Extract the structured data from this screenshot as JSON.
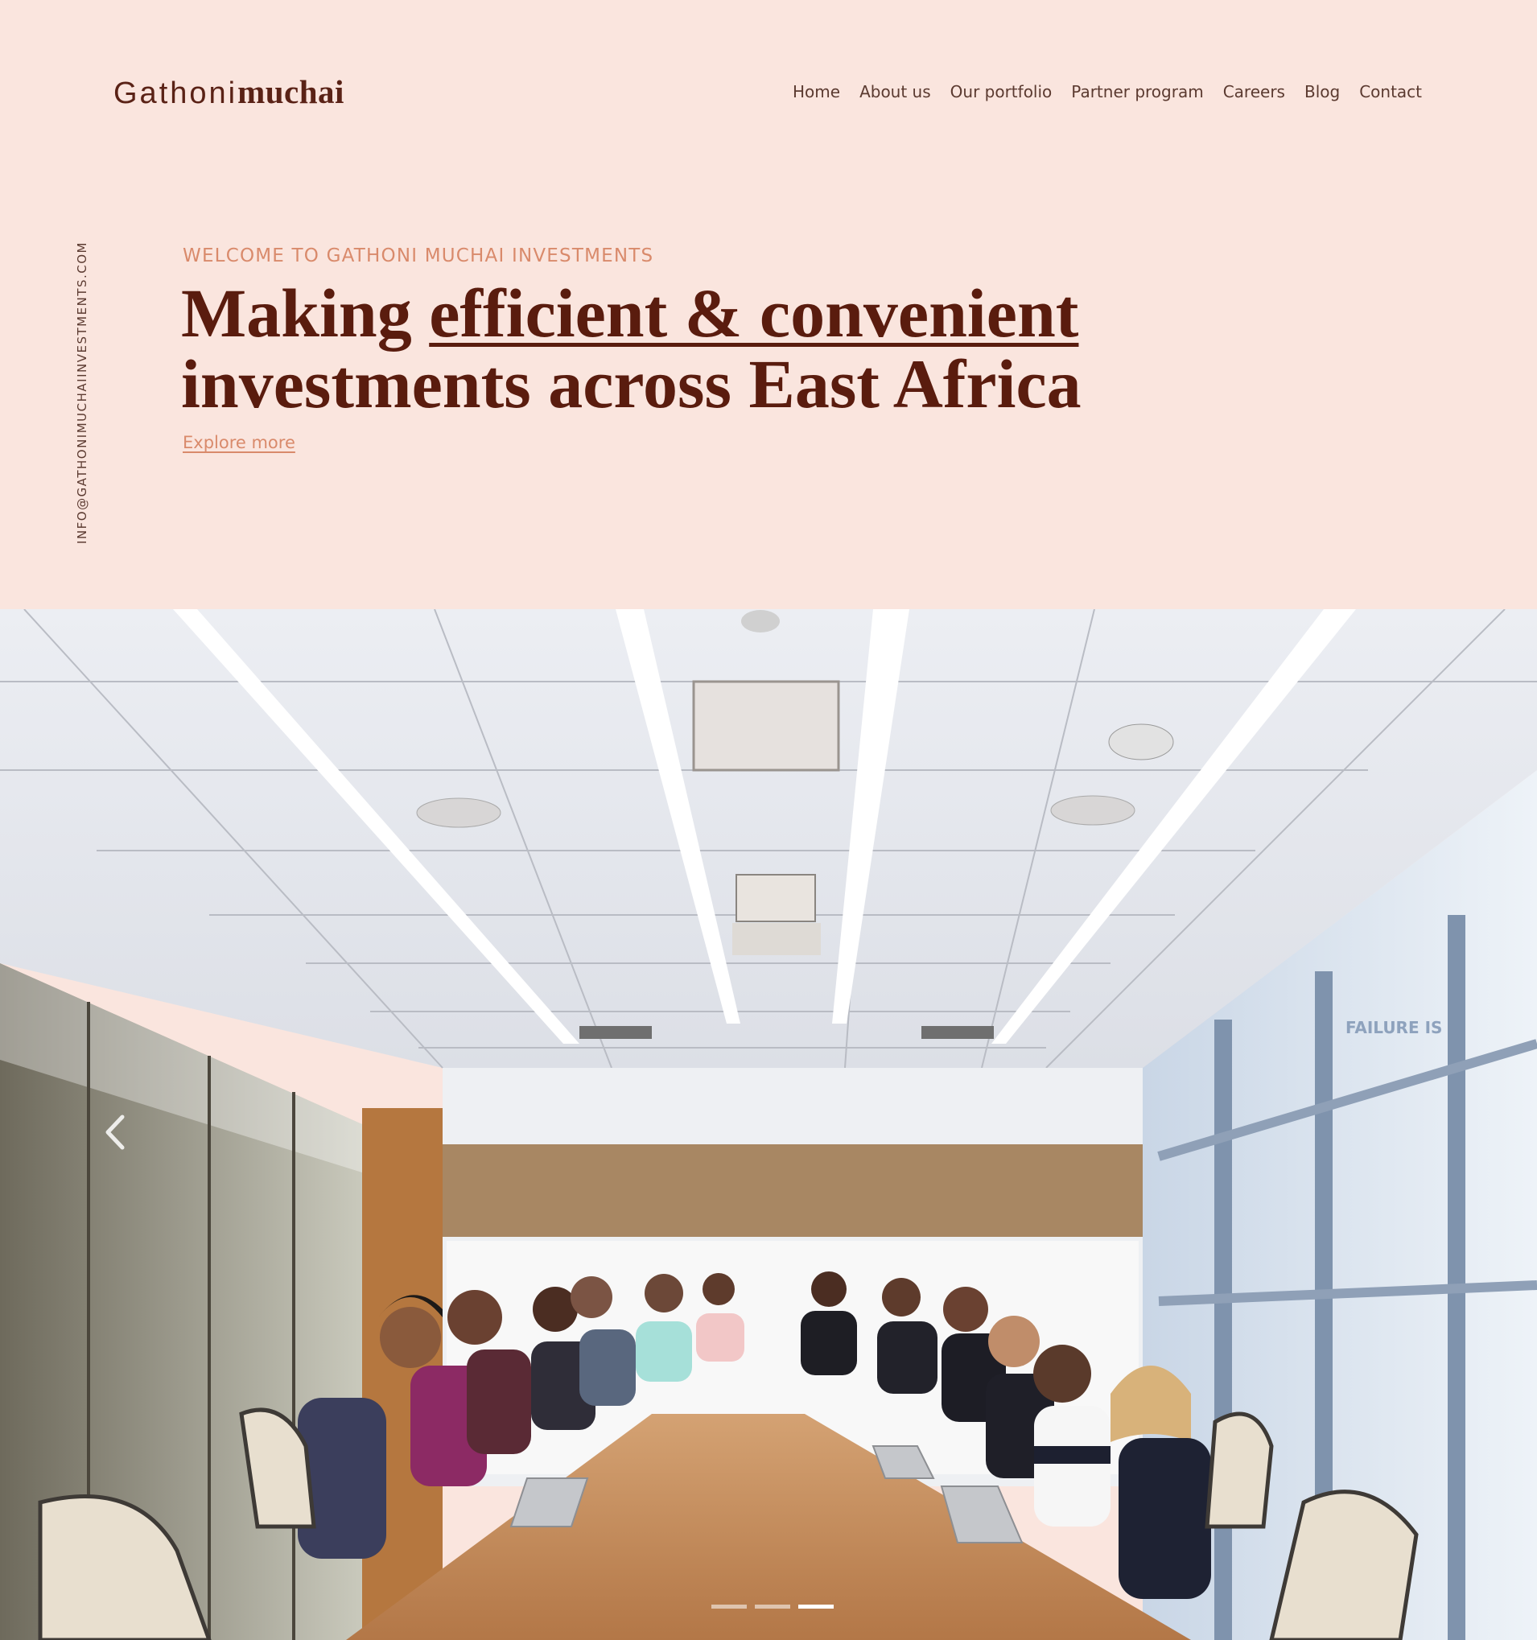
{
  "brand": {
    "name_light": "Gathoni",
    "name_bold": "muchai"
  },
  "nav": {
    "items": [
      "Home",
      "About us",
      "Our portfolio",
      "Partner program",
      "Careers",
      "Blog",
      "Contact"
    ]
  },
  "side": {
    "email": "INFO@GATHONIMUCHAIINVESTMENTS.COM"
  },
  "hero": {
    "eyebrow": "WELCOME TO GATHONI MUCHAI INVESTMENTS",
    "headline_part1": "Making ",
    "headline_highlight": "efficient & convenient",
    "headline_line2": "investments across East Africa",
    "cta": "Explore more"
  },
  "slider": {
    "prev_icon": "chevron-left-icon",
    "window_sign": "FAILURE IS"
  },
  "colors": {
    "background": "#fae5de",
    "brand_dark": "#5a1c0e",
    "accent": "#d98a6b",
    "nav_text": "#5b3a30"
  }
}
